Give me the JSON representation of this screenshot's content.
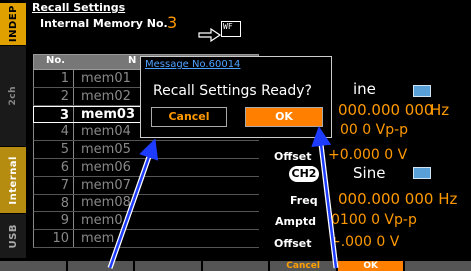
{
  "tabs": {
    "indep": "INDEP",
    "twoch": "2ch",
    "internal": "Internal",
    "usb": "USB"
  },
  "header": {
    "title": "Recall Settings",
    "memory_label": "Internal Memory No.",
    "memory_value": "3",
    "wf_icon_text": "WF"
  },
  "memory_table": {
    "col_no": "No.",
    "col_name": "N",
    "rows": [
      {
        "no": "1",
        "name": "mem01"
      },
      {
        "no": "2",
        "name": "mem02"
      },
      {
        "no": "3",
        "name": "mem03"
      },
      {
        "no": "4",
        "name": "mem04"
      },
      {
        "no": "5",
        "name": "mem05"
      },
      {
        "no": "6",
        "name": "mem06"
      },
      {
        "no": "7",
        "name": "mem07"
      },
      {
        "no": "8",
        "name": "mem08"
      },
      {
        "no": "9",
        "name": "mem0"
      },
      {
        "no": "10",
        "name": "mem"
      }
    ]
  },
  "ch1": {
    "waveform": "ine",
    "freq": "000.000 000",
    "freq_unit": "Hz",
    "amptd": "00 0 Vp-p",
    "offset_label": "Offset",
    "offset_value": "+0.000 0 V"
  },
  "ch2": {
    "badge": "CH2",
    "waveform": "Sine",
    "freq_label": "Freq",
    "freq": "000.000 000 Hz",
    "amptd_label": "Amptd",
    "amptd": "0100 0 Vp-p",
    "offset_label": "Offset",
    "offset_value": "+.000 0 V"
  },
  "dialog": {
    "title": "Message No.60014",
    "message": "Recall Settings Ready?",
    "cancel_label": "Cancel",
    "ok_label": "OK"
  },
  "softkeys": [
    "",
    "",
    "",
    "",
    "Cancel",
    "OK",
    ""
  ],
  "colors": {
    "accent_orange": "#ff9900",
    "ok_fill": "#ff8000",
    "title_blue": "#4ea2ff",
    "indep_tab": "#e0a000",
    "internal_tab": "#b58b10",
    "annotation_arrow": "#1e3cff"
  }
}
